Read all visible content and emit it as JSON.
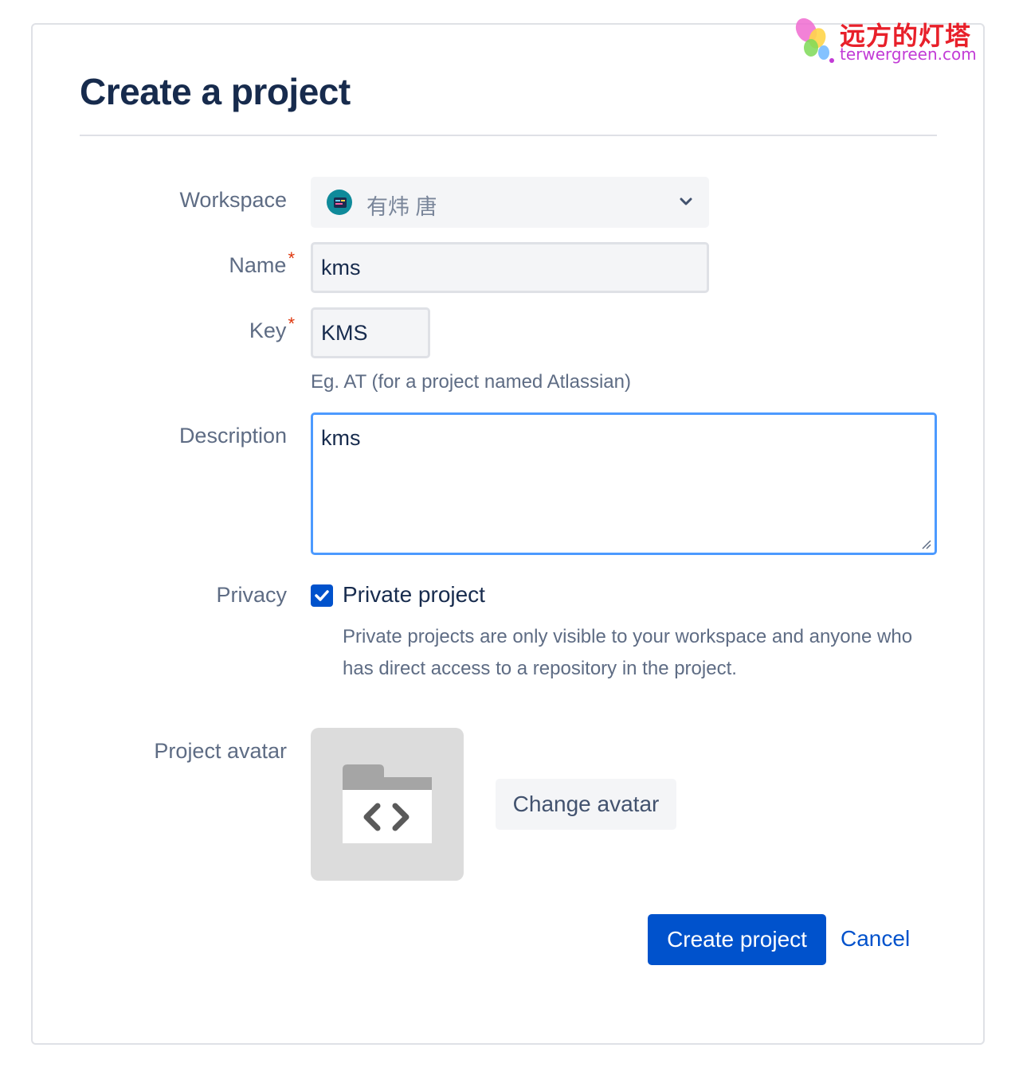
{
  "header": {
    "title": "Create a project"
  },
  "form": {
    "workspace": {
      "label": "Workspace",
      "value": "有炜 唐"
    },
    "name": {
      "label": "Name",
      "required_mark": "*",
      "value": "kms"
    },
    "key": {
      "label": "Key",
      "required_mark": "*",
      "value": "KMS",
      "hint": "Eg. AT (for a project named Atlassian)"
    },
    "description": {
      "label": "Description",
      "value": "kms"
    },
    "privacy": {
      "label": "Privacy",
      "checkbox_label": "Private project",
      "checked": true,
      "description": "Private projects are only visible to your workspace and anyone who has direct access to a repository in the project."
    },
    "avatar": {
      "label": "Project avatar",
      "change_label": "Change avatar"
    }
  },
  "actions": {
    "create_label": "Create project",
    "cancel_label": "Cancel"
  },
  "watermark": {
    "cn": "远方的灯塔",
    "en": "terwergreen.com"
  },
  "colors": {
    "primary": "#0052cc",
    "focus": "#4c9aff",
    "required": "#de350b",
    "heading": "#172b4d",
    "muted": "#5e6c84"
  }
}
